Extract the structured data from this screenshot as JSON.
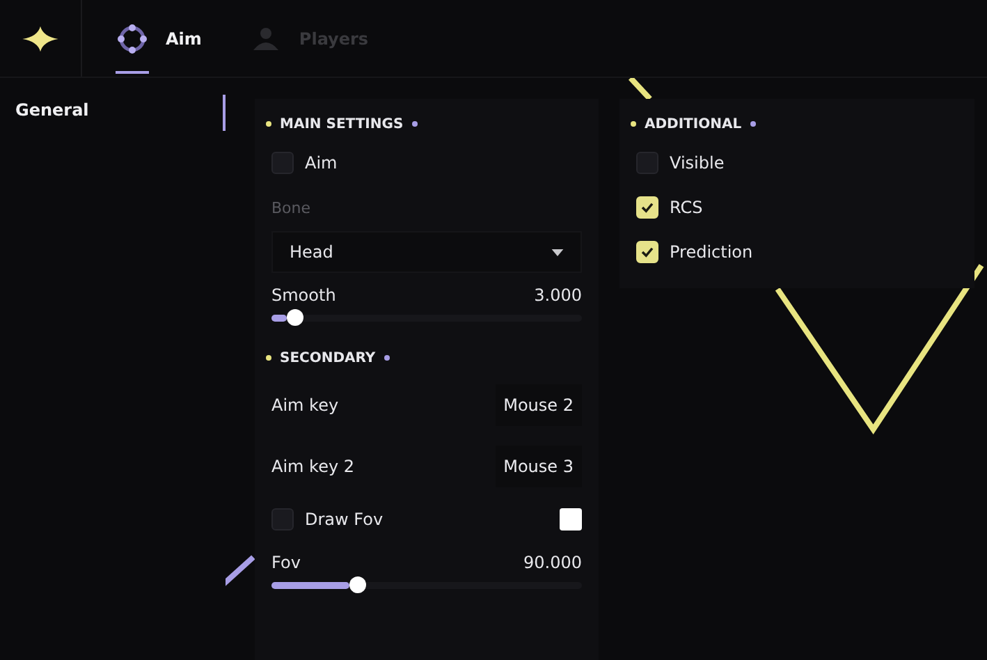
{
  "tabs": [
    {
      "label": "Aim",
      "selected": true
    },
    {
      "label": "Players",
      "selected": false
    }
  ],
  "sidebar": {
    "items": [
      {
        "label": "General",
        "selected": true
      }
    ]
  },
  "columns": [
    {
      "sections": [
        {
          "title": "MAIN SETTINGS",
          "rows": [
            {
              "kind": "checkbox",
              "label": "Aim",
              "checked": false
            },
            {
              "kind": "caption",
              "label": "Bone",
              "disabled": true
            },
            {
              "kind": "dropdown",
              "value": "Head"
            },
            {
              "kind": "slider",
              "label": "Smooth",
              "reading": "3.000",
              "level": 0.05
            }
          ]
        },
        {
          "title": "SECONDARY",
          "rows": [
            {
              "kind": "keybind",
              "label": "Aim key",
              "value": "Mouse 2"
            },
            {
              "kind": "keybind",
              "label": "Aim key 2",
              "value": "Mouse 3"
            },
            {
              "kind": "checkbox",
              "label": "Draw Fov",
              "checked": false,
              "color": "#ffffff"
            },
            {
              "kind": "slider",
              "label": "Fov",
              "reading": "90.000",
              "level": 0.25
            }
          ]
        }
      ]
    },
    {
      "sections": [
        {
          "title": "ADDITIONAL",
          "rows": [
            {
              "kind": "checkbox",
              "label": "Visible",
              "checked": false
            },
            {
              "kind": "checkbox",
              "label": "RCS",
              "checked": true
            },
            {
              "kind": "checkbox",
              "label": "Prediction",
              "checked": true
            }
          ]
        }
      ]
    }
  ]
}
